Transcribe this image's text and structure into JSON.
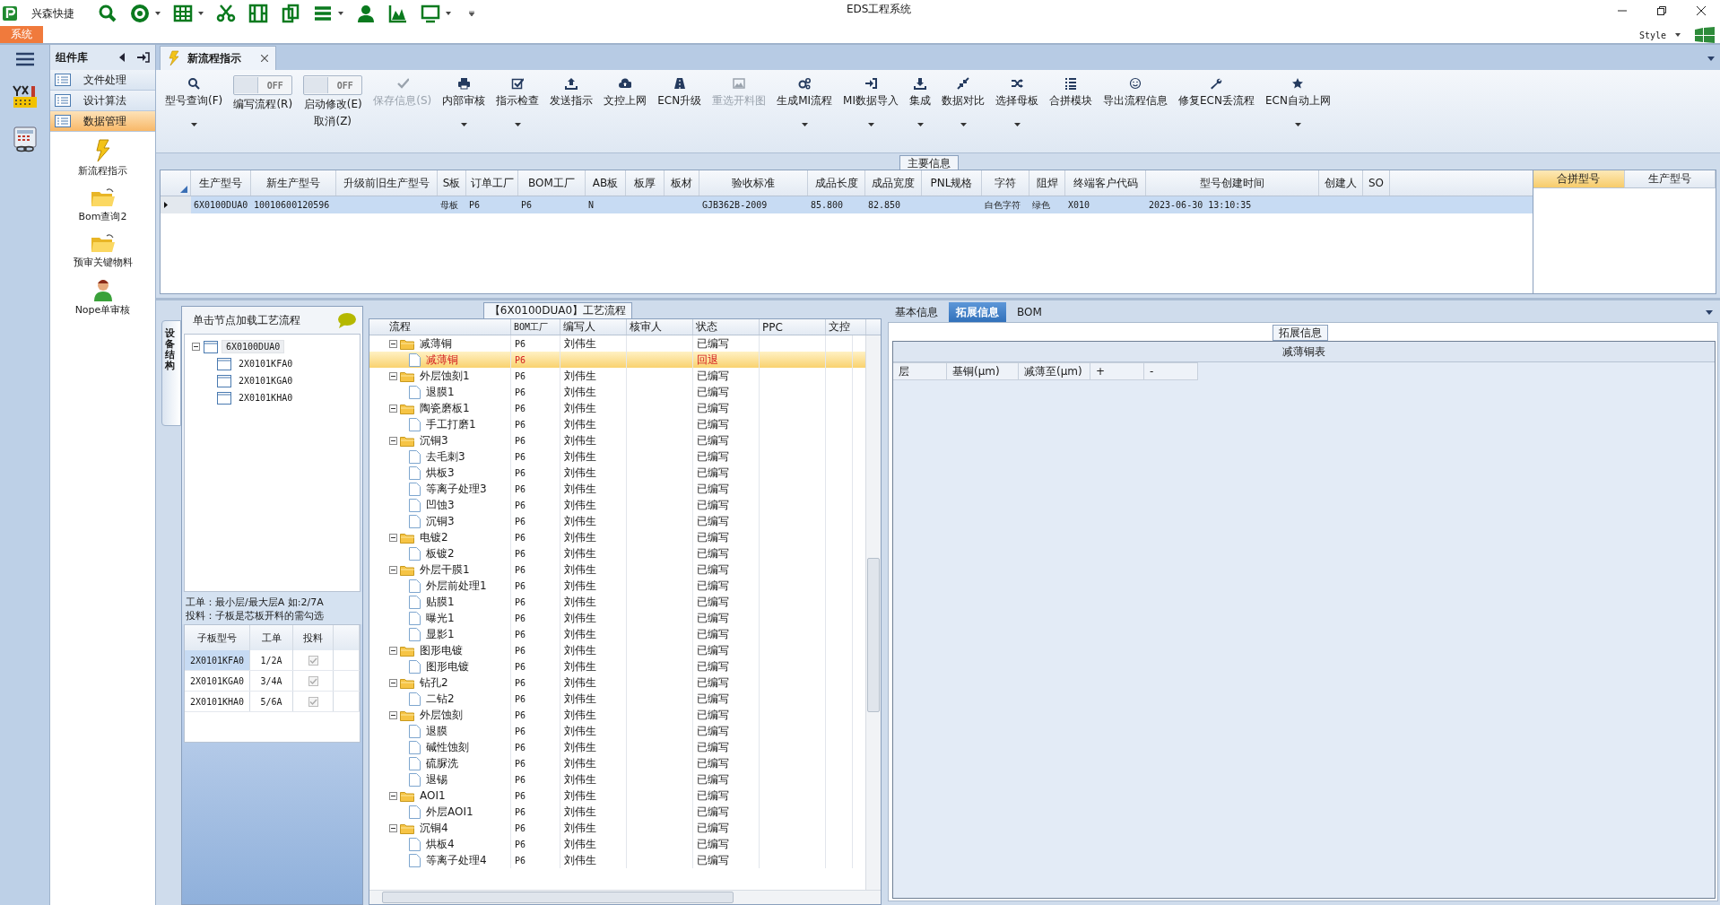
{
  "app": {
    "name": "兴森快捷",
    "title": "EDS工程系统",
    "menu_tab": "系统",
    "style_menu": "Style"
  },
  "sidebar": {
    "title": "组件库",
    "nav": [
      {
        "label": "文件处理",
        "selected": false
      },
      {
        "label": "设计算法",
        "selected": false
      },
      {
        "label": "数据管理",
        "selected": true
      }
    ],
    "tools": [
      {
        "label": "新流程指示"
      },
      {
        "label": "Bom查询2"
      },
      {
        "label": "预审关键物料"
      },
      {
        "label": "Nope单审核"
      }
    ]
  },
  "document_tabs": [
    {
      "label": "新流程指示",
      "selected": true
    }
  ],
  "toolbar": [
    {
      "kind": "button",
      "label": "型号查询(F)",
      "dropdown": true,
      "disabled": false
    },
    {
      "kind": "toggle",
      "label": "编写流程(R)",
      "toggle_text": "OFF",
      "on": false
    },
    {
      "kind": "toggle",
      "label": "启动修改(E)",
      "label2": "取消(Z)",
      "toggle_text": "OFF",
      "on": false
    },
    {
      "kind": "button",
      "label": "保存信息(S)",
      "dropdown": false,
      "disabled": true
    },
    {
      "kind": "button",
      "label": "内部审核",
      "dropdown": true,
      "disabled": false
    },
    {
      "kind": "button",
      "label": "指示检查",
      "dropdown": true,
      "disabled": false
    },
    {
      "kind": "button",
      "label": "发送指示",
      "dropdown": false,
      "disabled": false
    },
    {
      "kind": "button",
      "label": "文控上网",
      "dropdown": false,
      "disabled": false
    },
    {
      "kind": "button",
      "label": "ECN升级",
      "dropdown": false,
      "disabled": false
    },
    {
      "kind": "button",
      "label": "重选开料图",
      "dropdown": false,
      "disabled": true
    },
    {
      "kind": "button",
      "label": "生成MI流程",
      "dropdown": true,
      "disabled": false
    },
    {
      "kind": "button",
      "label": "MI数据导入",
      "dropdown": true,
      "disabled": false
    },
    {
      "kind": "button",
      "label": "集成",
      "dropdown": true,
      "disabled": false
    },
    {
      "kind": "button",
      "label": "数据对比",
      "dropdown": true,
      "disabled": false
    },
    {
      "kind": "button",
      "label": "选择母板",
      "dropdown": true,
      "disabled": false
    },
    {
      "kind": "button",
      "label": "合拼模块",
      "dropdown": false,
      "disabled": false
    },
    {
      "kind": "button",
      "label": "导出流程信息",
      "dropdown": false,
      "disabled": false
    },
    {
      "kind": "button",
      "label": "修复ECN丢流程",
      "dropdown": false,
      "disabled": false
    },
    {
      "kind": "button",
      "label": "ECN自动上网",
      "dropdown": true,
      "disabled": false
    }
  ],
  "main_info": {
    "title": "主要信息",
    "columns": [
      "生产型号",
      "新生产型号",
      "升级前旧生产型号",
      "S板",
      "订单工厂",
      "BOM工厂",
      "AB板",
      "板厚",
      "板材",
      "验收标准",
      "成品长度",
      "成品宽度",
      "PNL规格",
      "字符",
      "阻焊",
      "终端客户代码",
      "型号创建时间",
      "创建人",
      "SO"
    ],
    "rows": [
      {
        "selected": true,
        "cells": [
          "6X0100DUA0",
          "10010600120596",
          null,
          "母板",
          "P6",
          "P6",
          "N",
          null,
          null,
          "GJB362B-2009",
          "85.800",
          "82.850",
          null,
          "白色字符",
          "绿色",
          "X010",
          "2023-06-30 13:10:35",
          null,
          null
        ]
      }
    ],
    "side_table": {
      "columns": [
        {
          "label": "合拼型号",
          "selected": true
        },
        {
          "label": "生产型号",
          "selected": false
        }
      ]
    }
  },
  "structure": {
    "tab": "设备结构",
    "hint": "单击节点加载工艺流程",
    "tree": {
      "label": "6X0100DUA0",
      "expanded": true,
      "selected": true,
      "children": [
        {
          "label": "2X0101KFA0",
          "selected": false
        },
        {
          "label": "2X0101KGA0",
          "selected": false
        },
        {
          "label": "2X0101KHA0",
          "selected": false
        }
      ]
    },
    "note": [
      "工单：最小层/最大层A 如:2/7A",
      "投料：子板是芯板开料的需勾选"
    ],
    "columns": [
      "子板型号",
      "工单",
      "投料"
    ],
    "rows": [
      {
        "board": "2X0101KFA0",
        "order": "1/2A",
        "checked": true,
        "selected": true
      },
      {
        "board": "2X0101KGA0",
        "order": "3/4A",
        "checked": true,
        "selected": false
      },
      {
        "board": "2X0101KHA0",
        "order": "5/6A",
        "checked": true,
        "selected": false
      }
    ]
  },
  "process_flow": {
    "title": "【6X0100DUA0】工艺流程",
    "columns": [
      "流程",
      "BOM工厂",
      "编写人",
      "核审人",
      "状态",
      "PPC",
      "文控"
    ],
    "rows": [
      {
        "name": "减薄铜",
        "bom_factory": "P6",
        "writer": "刘伟生",
        "status": "已编写",
        "expanded": true,
        "selected": false,
        "children": [
          {
            "name": "减薄铜",
            "bom_factory": "P6",
            "status": "回退",
            "selected": true
          }
        ]
      },
      {
        "name": "外层蚀刻1",
        "bom_factory": "P6",
        "writer": "刘伟生",
        "status": "已编写",
        "expanded": true,
        "selected": false,
        "children": [
          {
            "name": "退膜1",
            "bom_factory": "P6",
            "writer": "刘伟生",
            "status": "已编写",
            "selected": false
          }
        ]
      },
      {
        "name": "陶瓷磨板1",
        "bom_factory": "P6",
        "writer": "刘伟生",
        "status": "已编写",
        "expanded": true,
        "selected": false,
        "children": [
          {
            "name": "手工打磨1",
            "bom_factory": "P6",
            "writer": "刘伟生",
            "status": "已编写",
            "selected": false
          }
        ]
      },
      {
        "name": "沉铜3",
        "bom_factory": "P6",
        "writer": "刘伟生",
        "status": "已编写",
        "expanded": true,
        "selected": false,
        "children": [
          {
            "name": "去毛刺3",
            "bom_factory": "P6",
            "writer": "刘伟生",
            "status": "已编写",
            "selected": false
          },
          {
            "name": "烘板3",
            "bom_factory": "P6",
            "writer": "刘伟生",
            "status": "已编写",
            "selected": false
          },
          {
            "name": "等离子处理3",
            "bom_factory": "P6",
            "writer": "刘伟生",
            "status": "已编写",
            "selected": false
          },
          {
            "name": "凹蚀3",
            "bom_factory": "P6",
            "writer": "刘伟生",
            "status": "已编写",
            "selected": false
          },
          {
            "name": "沉铜3",
            "bom_factory": "P6",
            "writer": "刘伟生",
            "status": "已编写",
            "selected": false
          }
        ]
      },
      {
        "name": "电镀2",
        "bom_factory": "P6",
        "writer": "刘伟生",
        "status": "已编写",
        "expanded": true,
        "selected": false,
        "children": [
          {
            "name": "板镀2",
            "bom_factory": "P6",
            "writer": "刘伟生",
            "status": "已编写",
            "selected": false
          }
        ]
      },
      {
        "name": "外层干膜1",
        "bom_factory": "P6",
        "writer": "刘伟生",
        "status": "已编写",
        "expanded": true,
        "selected": false,
        "children": [
          {
            "name": "外层前处理1",
            "bom_factory": "P6",
            "writer": "刘伟生",
            "status": "已编写",
            "selected": false
          },
          {
            "name": "贴膜1",
            "bom_factory": "P6",
            "writer": "刘伟生",
            "status": "已编写",
            "selected": false
          },
          {
            "name": "曝光1",
            "bom_factory": "P6",
            "writer": "刘伟生",
            "status": "已编写",
            "selected": false
          },
          {
            "name": "显影1",
            "bom_factory": "P6",
            "writer": "刘伟生",
            "status": "已编写",
            "selected": false
          }
        ]
      },
      {
        "name": "图形电镀",
        "bom_factory": "P6",
        "writer": "刘伟生",
        "status": "已编写",
        "expanded": true,
        "selected": false,
        "children": [
          {
            "name": "图形电镀",
            "bom_factory": "P6",
            "writer": "刘伟生",
            "status": "已编写",
            "selected": false
          }
        ]
      },
      {
        "name": "钻孔2",
        "bom_factory": "P6",
        "writer": "刘伟生",
        "status": "已编写",
        "expanded": true,
        "selected": false,
        "children": [
          {
            "name": "二钻2",
            "bom_factory": "P6",
            "writer": "刘伟生",
            "status": "已编写",
            "selected": false
          }
        ]
      },
      {
        "name": "外层蚀刻",
        "bom_factory": "P6",
        "writer": "刘伟生",
        "status": "已编写",
        "expanded": true,
        "selected": false,
        "children": [
          {
            "name": "退膜",
            "bom_factory": "P6",
            "writer": "刘伟生",
            "status": "已编写",
            "selected": false
          },
          {
            "name": "碱性蚀刻",
            "bom_factory": "P6",
            "writer": "刘伟生",
            "status": "已编写",
            "selected": false
          },
          {
            "name": "硫脲洗",
            "bom_factory": "P6",
            "writer": "刘伟生",
            "status": "已编写",
            "selected": false
          },
          {
            "name": "退锡",
            "bom_factory": "P6",
            "writer": "刘伟生",
            "status": "已编写",
            "selected": false
          }
        ]
      },
      {
        "name": "AOI1",
        "bom_factory": "P6",
        "writer": "刘伟生",
        "status": "已编写",
        "expanded": true,
        "selected": false,
        "children": [
          {
            "name": "外层AOI1",
            "bom_factory": "P6",
            "writer": "刘伟生",
            "status": "已编写",
            "selected": false
          }
        ]
      },
      {
        "name": "沉铜4",
        "bom_factory": "P6",
        "writer": "刘伟生",
        "status": "已编写",
        "expanded": true,
        "selected": false,
        "children": [
          {
            "name": "烘板4",
            "bom_factory": "P6",
            "writer": "刘伟生",
            "status": "已编写",
            "selected": false
          },
          {
            "name": "等离子处理4",
            "bom_factory": "P6",
            "writer": "刘伟生",
            "status": "已编写",
            "selected": false
          }
        ]
      }
    ]
  },
  "details": {
    "tabs": [
      {
        "label": "基本信息",
        "selected": false
      },
      {
        "label": "拓展信息",
        "selected": true
      },
      {
        "label": "BOM",
        "selected": false
      }
    ],
    "group_title": "拓展信息",
    "table_title": "减薄铜表",
    "columns": [
      "层",
      "基铜(μm)",
      "减薄至(μm)",
      "+",
      "-"
    ]
  }
}
